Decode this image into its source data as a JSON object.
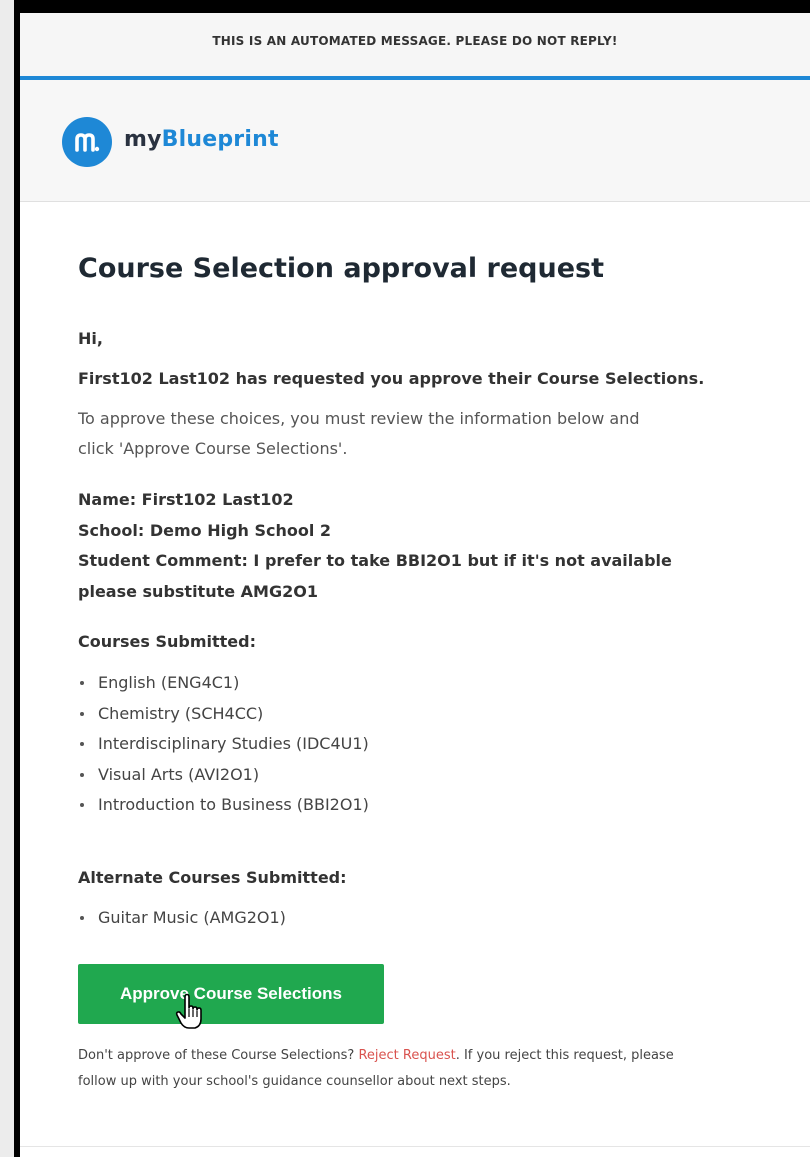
{
  "notice": "THIS IS AN AUTOMATED MESSAGE. PLEASE DO NOT REPLY!",
  "brand": {
    "prefix": "my",
    "accent": "Blueprint",
    "logo_icon": "myblueprint-m-icon"
  },
  "email": {
    "title": "Course Selection approval request",
    "greeting": "Hi,",
    "request_line": "First102 Last102 has requested you approve their Course Selections.",
    "instruction_line1": "To approve these choices, you must review the information below and",
    "instruction_line2": "click 'Approve Course Selections'.",
    "name": "Name: First102 Last102",
    "school": "School: Demo High School 2",
    "comment_line1": "Student Comment: I prefer to take BBI2O1 but if it's not available",
    "comment_line2": "please substitute AMG2O1",
    "courses_heading": "Courses Submitted:",
    "courses": [
      "English (ENG4C1)",
      "Chemistry (SCH4CC)",
      "Interdisciplinary Studies (IDC4U1)",
      "Visual Arts (AVI2O1)",
      "Introduction to Business (BBI2O1)"
    ],
    "alternates_heading": "Alternate Courses Submitted:",
    "alternates": [
      "Guitar Music (AMG2O1)"
    ],
    "approve_button": "Approve Course Selections",
    "footer_before": "Don't approve of these Course Selections? ",
    "reject_link": "Reject Request",
    "footer_after": ". If you reject this request, please",
    "footer_line2": "follow up with your school's guidance counsellor about next steps."
  },
  "colors": {
    "accent_blue": "#1e88d6",
    "approve_green": "#20a84f",
    "reject_red": "#d9534f"
  }
}
